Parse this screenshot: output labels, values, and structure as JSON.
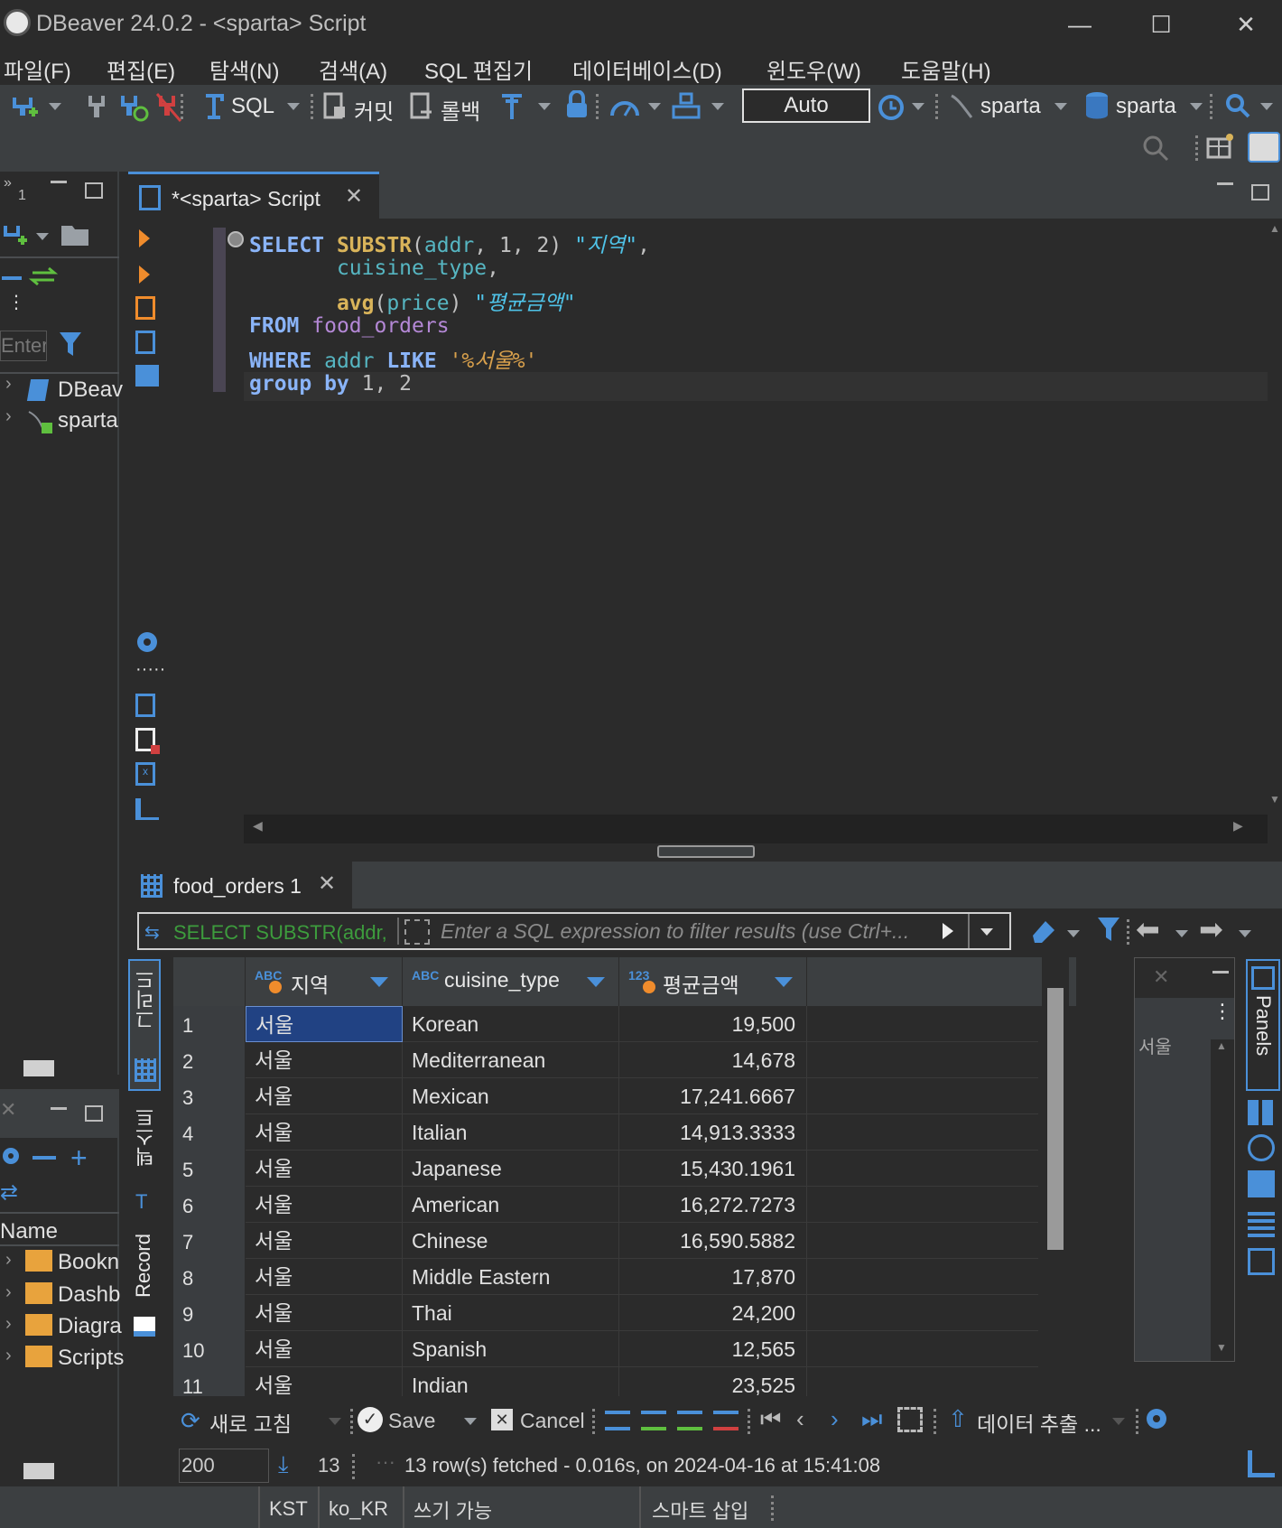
{
  "window": {
    "title": "DBeaver 24.0.2 - <sparta> Script",
    "minimize": "—",
    "maximize": "☐",
    "close": "✕"
  },
  "menu": [
    "파일(F)",
    "편집(E)",
    "탐색(N)",
    "검색(A)",
    "SQL 편집기",
    "데이터베이스(D)",
    "윈도우(W)",
    "도움말(H)"
  ],
  "toolbar": {
    "sql": "SQL",
    "commit": "커밋",
    "rollback": "롤백",
    "transaction_mode": "Auto",
    "datasource": "sparta",
    "schema": "sparta"
  },
  "left_panel": {
    "search_placeholder": "Enter",
    "tree": [
      "DBeav",
      "sparta"
    ],
    "projects_header": "Name",
    "projects": [
      "Bookn",
      "Dashb",
      "Diagra",
      "Scripts"
    ],
    "badge": "1"
  },
  "editor": {
    "tab_title": "*<sparta> Script",
    "lines": [
      [
        [
          "kw",
          "SELECT "
        ],
        [
          "fn",
          "SUBSTR"
        ],
        [
          "pl",
          "("
        ],
        [
          "id",
          "addr"
        ],
        [
          "pl",
          ", 1, 2) "
        ],
        [
          "al",
          "\"지역\""
        ],
        [
          "pl",
          ","
        ]
      ],
      [
        [
          "pl",
          "       "
        ],
        [
          "id",
          "cuisine_type"
        ],
        [
          "pl",
          ","
        ]
      ],
      [
        [
          "pl",
          "       "
        ],
        [
          "fn",
          "avg"
        ],
        [
          "pl",
          "("
        ],
        [
          "id",
          "price"
        ],
        [
          "pl",
          ") "
        ],
        [
          "al",
          "\"평균금액\""
        ]
      ],
      [
        [
          "kw",
          "FROM "
        ],
        [
          "tbl",
          "food_orders"
        ]
      ],
      [
        [
          "kw",
          "WHERE "
        ],
        [
          "id",
          "addr"
        ],
        [
          "kw",
          " LIKE "
        ],
        [
          "str",
          "'%서울%'"
        ]
      ],
      [
        [
          "kw",
          "group by "
        ],
        [
          "pl",
          "1, 2"
        ]
      ]
    ]
  },
  "results": {
    "tab_title": "food_orders 1",
    "query_preview": "SELECT SUBSTR(addr, 1,",
    "filter_placeholder": "Enter a SQL expression to filter results (use Ctrl+...",
    "columns": [
      {
        "type": "ABC",
        "name": "지역"
      },
      {
        "type": "ABC",
        "name": "cuisine_type"
      },
      {
        "type": "123",
        "name": "평균금액"
      }
    ],
    "rows": [
      [
        "1",
        "서울",
        "Korean",
        "19,500"
      ],
      [
        "2",
        "서울",
        "Mediterranean",
        "14,678"
      ],
      [
        "3",
        "서울",
        "Mexican",
        "17,241.6667"
      ],
      [
        "4",
        "서울",
        "Italian",
        "14,913.3333"
      ],
      [
        "5",
        "서울",
        "Japanese",
        "15,430.1961"
      ],
      [
        "6",
        "서울",
        "American",
        "16,272.7273"
      ],
      [
        "7",
        "서울",
        "Chinese",
        "16,590.5882"
      ],
      [
        "8",
        "서울",
        "Middle Eastern",
        "17,870"
      ],
      [
        "9",
        "서울",
        "Thai",
        "24,200"
      ],
      [
        "10",
        "서울",
        "Spanish",
        "12,565"
      ],
      [
        "11",
        "서울",
        "Indian",
        "23,525"
      ]
    ],
    "vertical_tabs": [
      "그리드",
      "텍스트",
      "Record"
    ],
    "value_panel_text": "서울",
    "panels_label": "Panels",
    "bottom_toolbar": {
      "refresh": "새로 고침",
      "save": "Save",
      "cancel": "Cancel",
      "export": "데이터 추출 ..."
    },
    "fetch_size": "200",
    "row_count": "13",
    "status": "13 row(s) fetched - 0.016s, on 2024-04-16 at 15:41:08"
  },
  "statusbar": [
    "KST",
    "ko_KR",
    "쓰기 가능",
    "스마트 삽입"
  ],
  "colors": {
    "accent": "#2f6fb5",
    "selected_cell": "#214283",
    "keyword": "#8ab4f8",
    "function": "#d9b45a",
    "identifier": "#56b6c2",
    "table": "#b488d6",
    "string": "#d8a04c"
  }
}
